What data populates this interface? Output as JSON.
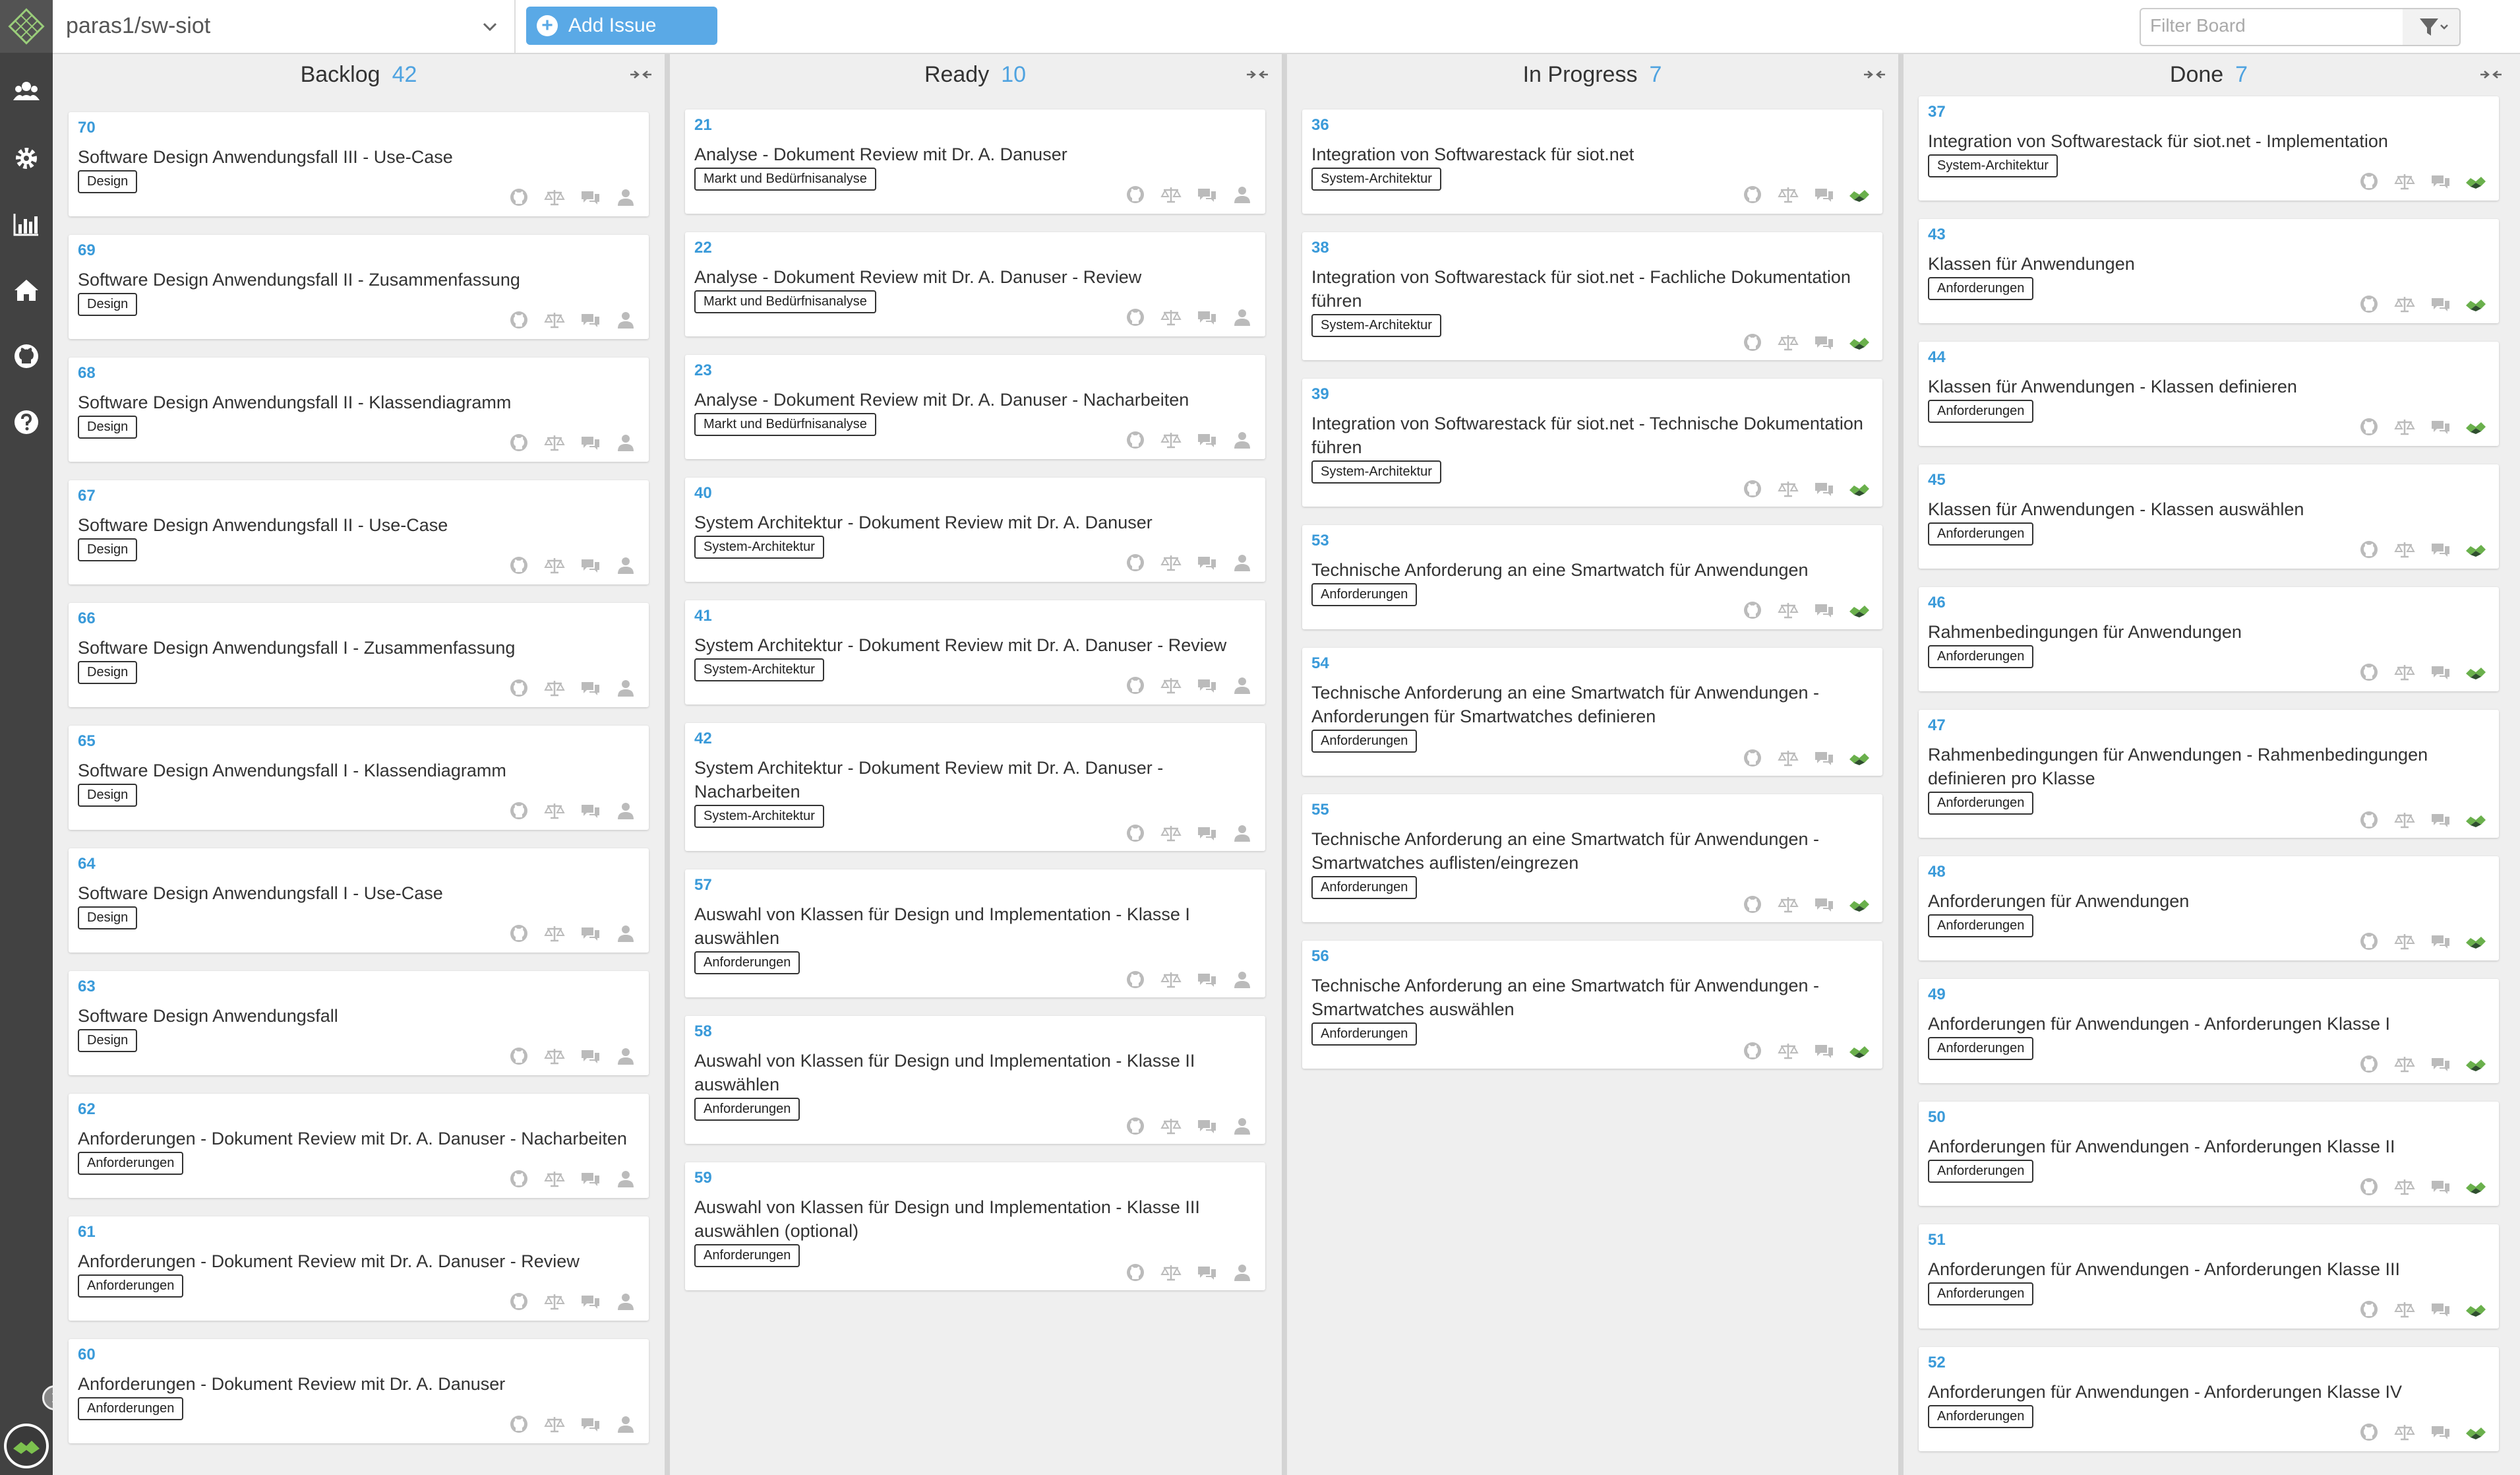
{
  "app": {
    "repo": "paras1/sw-siot",
    "add_issue_label": "Add Issue",
    "filter_placeholder": "Filter Board"
  },
  "sidebar": {
    "items": [
      "users-icon",
      "gear-icon",
      "chart-icon",
      "home-icon",
      "github-icon",
      "help-icon"
    ]
  },
  "colors": {
    "accent": "#4fa3e0",
    "button": "#5aa9e6",
    "sidebar": "#424242",
    "assignee_green": "#5a9a3a"
  },
  "columns": [
    {
      "title": "Backlog",
      "count": "42",
      "cards": [
        {
          "num": "70",
          "title": "Software Design Anwendungsfall III - Use-Case",
          "label": "Design",
          "lines": 1,
          "assigned": false
        },
        {
          "num": "69",
          "title": "Software Design Anwendungsfall II - Zusammenfassung",
          "label": "Design",
          "lines": 1,
          "assigned": false
        },
        {
          "num": "68",
          "title": "Software Design Anwendungsfall II - Klassendiagramm",
          "label": "Design",
          "lines": 1,
          "assigned": false
        },
        {
          "num": "67",
          "title": "Software Design Anwendungsfall II - Use-Case",
          "label": "Design",
          "lines": 1,
          "assigned": false
        },
        {
          "num": "66",
          "title": "Software Design Anwendungsfall I - Zusammenfassung",
          "label": "Design",
          "lines": 1,
          "assigned": false
        },
        {
          "num": "65",
          "title": "Software Design Anwendungsfall I - Klassendiagramm",
          "label": "Design",
          "lines": 1,
          "assigned": false
        },
        {
          "num": "64",
          "title": "Software Design Anwendungsfall I - Use-Case",
          "label": "Design",
          "lines": 1,
          "assigned": false
        },
        {
          "num": "63",
          "title": "Software Design Anwendungsfall",
          "label": "Design",
          "lines": 1,
          "assigned": false
        },
        {
          "num": "62",
          "title": "Anforderungen - Dokument Review mit Dr. A. Danuser - Nacharbeiten",
          "label": "Anforderungen",
          "lines": 1,
          "assigned": false
        },
        {
          "num": "61",
          "title": "Anforderungen - Dokument Review mit Dr. A. Danuser - Review",
          "label": "Anforderungen",
          "lines": 1,
          "assigned": false
        },
        {
          "num": "60",
          "title": "Anforderungen - Dokument Review mit Dr. A. Danuser",
          "label": "Anforderungen",
          "lines": 1,
          "assigned": false
        }
      ]
    },
    {
      "title": "Ready",
      "count": "10",
      "cards": [
        {
          "num": "21",
          "title": "Analyse - Dokument Review mit Dr. A. Danuser",
          "label": "Markt und Bedürfnisanalyse",
          "lines": 1,
          "assigned": false
        },
        {
          "num": "22",
          "title": "Analyse - Dokument Review mit Dr. A. Danuser - Review",
          "label": "Markt und Bedürfnisanalyse",
          "lines": 1,
          "assigned": false
        },
        {
          "num": "23",
          "title": "Analyse - Dokument Review mit Dr. A. Danuser - Nacharbeiten",
          "label": "Markt und Bedürfnisanalyse",
          "lines": 1,
          "assigned": false
        },
        {
          "num": "40",
          "title": "System Architektur - Dokument Review mit Dr. A. Danuser",
          "label": "System-Architektur",
          "lines": 1,
          "assigned": false
        },
        {
          "num": "41",
          "title": "System Architektur - Dokument Review mit Dr. A. Danuser - Review",
          "label": "System-Architektur",
          "lines": 1,
          "assigned": false
        },
        {
          "num": "42",
          "title": "System Architektur - Dokument Review mit Dr. A. Danuser - Nacharbeiten",
          "label": "System-Architektur",
          "lines": 2,
          "assigned": false
        },
        {
          "num": "57",
          "title": "Auswahl von Klassen für Design und Implementation - Klasse I auswählen",
          "label": "Anforderungen",
          "lines": 2,
          "assigned": false
        },
        {
          "num": "58",
          "title": "Auswahl von Klassen für Design und Implementation - Klasse II auswählen",
          "label": "Anforderungen",
          "lines": 2,
          "assigned": false
        },
        {
          "num": "59",
          "title": "Auswahl von Klassen für Design und Implementation - Klasse III auswählen (optional)",
          "label": "Anforderungen",
          "lines": 2,
          "assigned": false
        }
      ]
    },
    {
      "title": "In Progress",
      "count": "7",
      "cards": [
        {
          "num": "36",
          "title": "Integration von Softwarestack für siot.net",
          "label": "System-Architektur",
          "lines": 1,
          "assigned": true
        },
        {
          "num": "38",
          "title": "Integration von Softwarestack für siot.net - Fachliche Dokumentation führen",
          "label": "System-Architektur",
          "lines": 2,
          "assigned": true
        },
        {
          "num": "39",
          "title": "Integration von Softwarestack für siot.net - Technische Dokumentation führen",
          "label": "System-Architektur",
          "lines": 2,
          "assigned": true
        },
        {
          "num": "53",
          "title": "Technische Anforderung an eine Smartwatch für Anwendungen",
          "label": "Anforderungen",
          "lines": 1,
          "assigned": true
        },
        {
          "num": "54",
          "title": "Technische Anforderung an eine Smartwatch für Anwendungen - Anforderungen für Smartwatches definieren",
          "label": "Anforderungen",
          "lines": 2,
          "assigned": true
        },
        {
          "num": "55",
          "title": "Technische Anforderung an eine Smartwatch für Anwendungen - Smartwatches auflisten/eingrezen",
          "label": "Anforderungen",
          "lines": 2,
          "assigned": true
        },
        {
          "num": "56",
          "title": "Technische Anforderung an eine Smartwatch für Anwendungen - Smartwatches auswählen",
          "label": "Anforderungen",
          "lines": 2,
          "assigned": true
        }
      ]
    },
    {
      "title": "Done",
      "count": "7",
      "cards": [
        {
          "num": "37",
          "title": "Integration von Softwarestack für siot.net - Implementation",
          "label": "System-Architektur",
          "lines": 1,
          "assigned": true
        },
        {
          "num": "43",
          "title": "Klassen für Anwendungen",
          "label": "Anforderungen",
          "lines": 1,
          "assigned": true
        },
        {
          "num": "44",
          "title": "Klassen für Anwendungen - Klassen definieren",
          "label": "Anforderungen",
          "lines": 1,
          "assigned": true
        },
        {
          "num": "45",
          "title": "Klassen für Anwendungen - Klassen auswählen",
          "label": "Anforderungen",
          "lines": 1,
          "assigned": true
        },
        {
          "num": "46",
          "title": "Rahmenbedingungen für Anwendungen",
          "label": "Anforderungen",
          "lines": 1,
          "assigned": true
        },
        {
          "num": "47",
          "title": "Rahmenbedingungen für Anwendungen - Rahmenbedingungen definieren pro Klasse",
          "label": "Anforderungen",
          "lines": 2,
          "assigned": true
        },
        {
          "num": "48",
          "title": "Anforderungen für Anwendungen",
          "label": "Anforderungen",
          "lines": 1,
          "assigned": true
        },
        {
          "num": "49",
          "title": "Anforderungen für Anwendungen - Anforderungen Klasse I",
          "label": "Anforderungen",
          "lines": 1,
          "assigned": true
        },
        {
          "num": "50",
          "title": "Anforderungen für Anwendungen - Anforderungen Klasse II",
          "label": "Anforderungen",
          "lines": 1,
          "assigned": true
        },
        {
          "num": "51",
          "title": "Anforderungen für Anwendungen - Anforderungen Klasse III",
          "label": "Anforderungen",
          "lines": 1,
          "assigned": true
        },
        {
          "num": "52",
          "title": "Anforderungen für Anwendungen - Anforderungen Klasse IV",
          "label": "Anforderungen",
          "lines": 1,
          "assigned": true
        }
      ]
    }
  ]
}
